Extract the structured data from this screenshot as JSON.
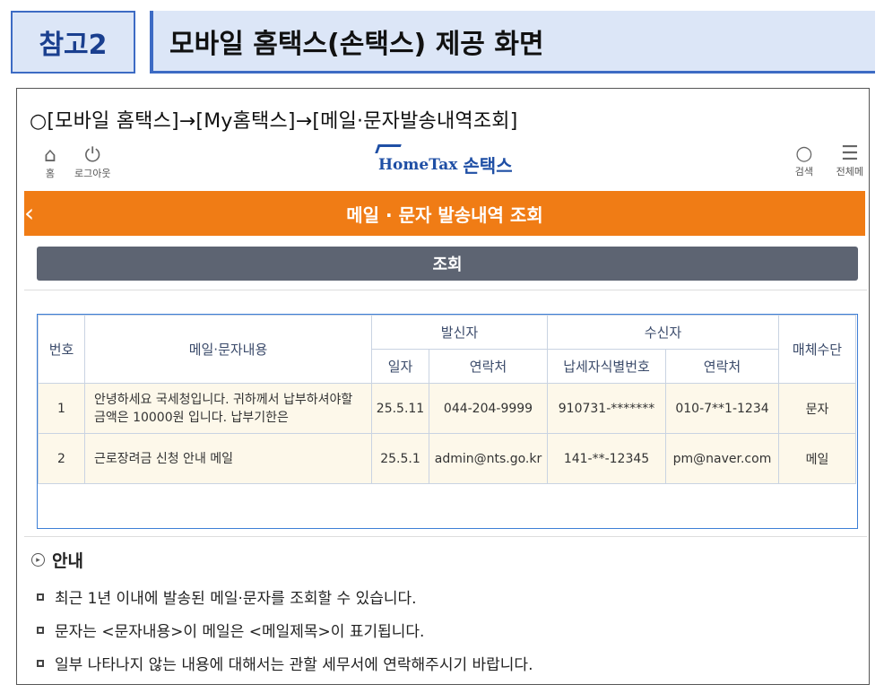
{
  "header": {
    "tag": "참고2",
    "title": "모바일 홈택스(손택스) 제공 화면"
  },
  "path": "○[모바일 홈택스]→[My홈택스]→[메일·문자발송내역조회]",
  "topbar": {
    "home_label": "홈",
    "logout_label": "로그아웃",
    "logo_en": "HomeTax",
    "logo_ko": "손택스",
    "search_label": "검색",
    "menu_label": "전체메"
  },
  "page_title": "메일 · 문자 발송내역 조회",
  "query_button": "조회",
  "table": {
    "headers": {
      "num": "번호",
      "content": "메일·문자내용",
      "sender": "발신자",
      "receiver": "수신자",
      "media": "매체수단",
      "date": "일자",
      "s_contact": "연락처",
      "taxpayer_id": "납세자식별번호",
      "r_contact": "연락처"
    },
    "rows": [
      {
        "num": "1",
        "content": "안녕하세요 국세청입니다. 귀하께서 납부하셔야할 금액은 10000원 입니다. 납부기한은",
        "date": "25.5.11",
        "s_contact": "044-204-9999",
        "taxpayer_id": "910731-*******",
        "r_contact": "010-7**1-1234",
        "media": "문자"
      },
      {
        "num": "2",
        "content": "근로장려금 신청 안내 메일",
        "date": "25.5.1",
        "s_contact": "admin@nts.go.kr",
        "taxpayer_id": "141-**-12345",
        "r_contact": "pm@naver.com",
        "media": "메일"
      }
    ]
  },
  "guide": {
    "title": "안내",
    "items": [
      "최근 1년 이내에 발송된 메일·문자를 조회할 수 있습니다.",
      "문자는 <문자내용>이 메일은 <메일제목>이 표기됩니다.",
      "일부 나타나지 않는 내용에 대해서는 관할 세무서에 연락해주시기 바랍니다."
    ]
  },
  "colors": {
    "accent_orange": "#f07c15",
    "header_blue": "#3d6bc4",
    "query_button": "#5d6472"
  }
}
